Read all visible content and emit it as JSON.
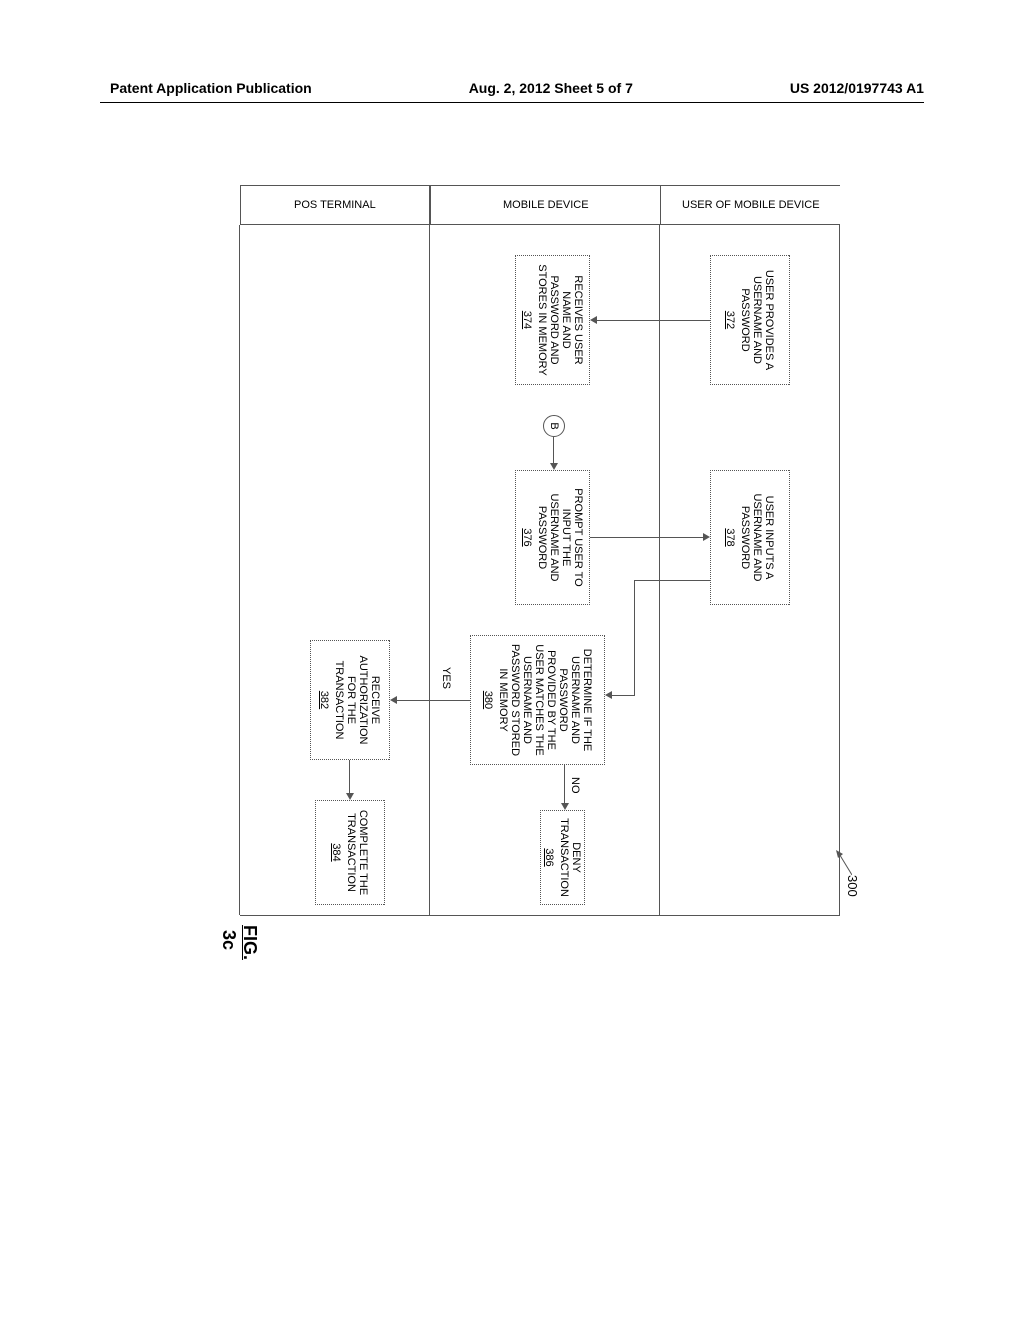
{
  "header": {
    "left": "Patent Application Publication",
    "center": "Aug. 2, 2012  Sheet 5 of 7",
    "right": "US 2012/0197743 A1"
  },
  "figure": {
    "caption_prefix": "FIG.",
    "caption_num": "3c",
    "ref_pointer": "300"
  },
  "lanes": {
    "user": "USER OF MOBILE DEVICE",
    "mobile": "MOBILE DEVICE",
    "pos": "POS TERMINAL"
  },
  "boxes": {
    "b372": {
      "text": "USER PROVIDES A USERNAME AND PASSWORD",
      "ref": "372"
    },
    "b374": {
      "text": "RECEIVES USER NAME AND PASSWORD AND STORES IN MEMORY",
      "ref": "374"
    },
    "b376": {
      "text": "PROMPT USER TO INPUT THE USERNAME AND PASSWORD",
      "ref": "376"
    },
    "b378": {
      "text": "USER INPUTS A USERNAME AND PASSWORD",
      "ref": "378"
    },
    "b380": {
      "text": "DETERMINE IF THE USERNAME AND PASSWORD PROVIDED BY THE USER MATCHES THE USERNAME AND PASSWORD STORED IN MEMORY",
      "ref": "380"
    },
    "b382": {
      "text": "RECEIVE AUTHORIZATION FOR THE TRANSACTION",
      "ref": "382"
    },
    "b384": {
      "text": "COMPLETE THE TRANSACTION",
      "ref": "384"
    },
    "b386": {
      "text": "DENY TRANSACTION",
      "ref": "386"
    }
  },
  "connector": {
    "b": "B"
  },
  "labels": {
    "yes": "YES",
    "no": "NO"
  }
}
